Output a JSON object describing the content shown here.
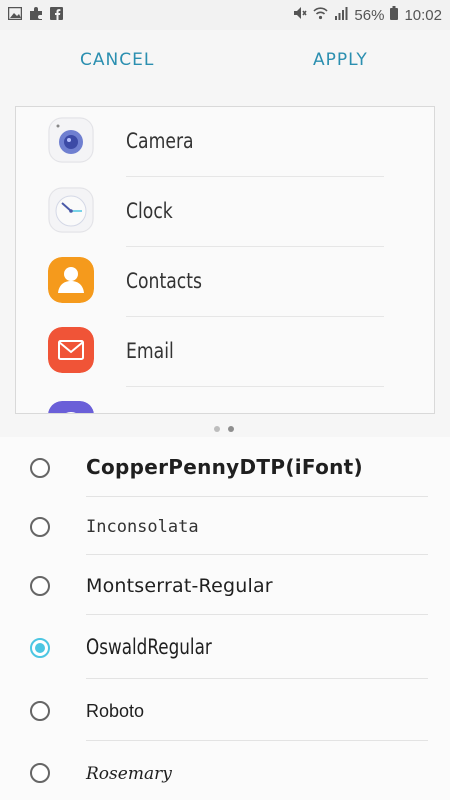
{
  "status_bar": {
    "battery_percent": "56%",
    "time": "10:02",
    "left_icons": [
      "gallery-icon",
      "puzzle-icon",
      "facebook-icon"
    ],
    "right_icons": [
      "mute-icon",
      "wifi-icon",
      "signal-icon",
      "battery-icon"
    ]
  },
  "actions": {
    "cancel_label": "CANCEL",
    "apply_label": "APPLY"
  },
  "preview": {
    "apps": [
      {
        "label": "Camera",
        "icon": "camera-icon"
      },
      {
        "label": "Clock",
        "icon": "clock-icon"
      },
      {
        "label": "Contacts",
        "icon": "contacts-icon"
      },
      {
        "label": "Email",
        "icon": "email-icon"
      }
    ],
    "page_dots": 2,
    "active_dot": 1
  },
  "fonts": {
    "items": [
      {
        "name": "CopperPennyDTP(iFont)",
        "selected": false
      },
      {
        "name": "Inconsolata",
        "selected": false
      },
      {
        "name": "Montserrat-Regular",
        "selected": false
      },
      {
        "name": "OswaldRegular",
        "selected": true
      },
      {
        "name": "Roboto",
        "selected": false
      },
      {
        "name": "Rosemary",
        "selected": false
      }
    ]
  },
  "colors": {
    "accent": "#2b8fb0",
    "radio_selected": "#4cc6e2",
    "contacts_orange": "#f59a1c",
    "email_red": "#f05437"
  }
}
